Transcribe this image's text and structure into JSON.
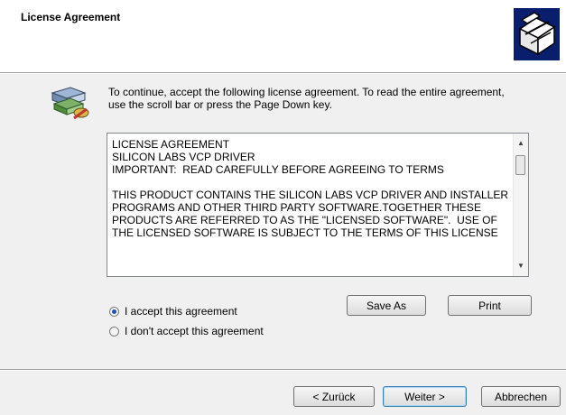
{
  "header": {
    "title": "License Agreement"
  },
  "intro": {
    "text": "To continue, accept the following license agreement. To read the entire agreement, use the scroll bar or press the Page Down key."
  },
  "license": {
    "text": "LICENSE AGREEMENT\nSILICON LABS VCP DRIVER\nIMPORTANT:  READ CAREFULLY BEFORE AGREEING TO TERMS\n\nTHIS PRODUCT CONTAINS THE SILICON LABS VCP DRIVER AND INSTALLER PROGRAMS AND OTHER THIRD PARTY SOFTWARE.TOGETHER THESE PRODUCTS ARE REFERRED TO AS THE \"LICENSED SOFTWARE\".  USE OF THE LICENSED SOFTWARE IS SUBJECT TO THE TERMS OF THIS LICENSE"
  },
  "options": {
    "accept_label": "I accept this agreement",
    "decline_label": "I don't accept this agreement",
    "selected": "accept"
  },
  "buttons": {
    "save_as": "Save As",
    "print": "Print",
    "back": "< Zurück",
    "next": "Weiter >",
    "cancel": "Abbrechen"
  },
  "icons": {
    "header_logo": "installer-box-icon",
    "intro": "setup-computer-icon"
  }
}
